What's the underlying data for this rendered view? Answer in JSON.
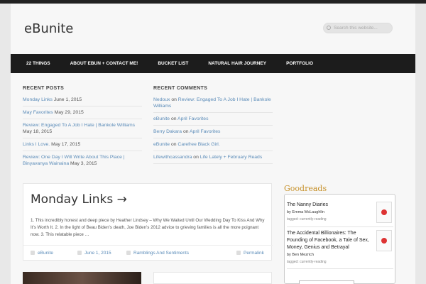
{
  "header": {
    "site_title": "eBunite",
    "search_placeholder": "Search this website..."
  },
  "nav": {
    "items": [
      "22 THINGS",
      "ABOUT EBUN + CONTACT ME!",
      "BUCKET LIST",
      "NATURAL HAIR JOURNEY",
      "PORTFOLIO"
    ]
  },
  "recent_posts": {
    "title": "RECENT POSTS",
    "items": [
      {
        "link": "Monday Links",
        "date": "June 1, 2015"
      },
      {
        "link": "May Favorites",
        "date": "May 29, 2015"
      },
      {
        "link": "Review: Engaged To A Job I Hate | Bankole Williams",
        "date": "May 18, 2015"
      },
      {
        "link": "Links I Love.",
        "date": "May 17, 2015"
      },
      {
        "link": "Review: One Day I Will Write About This Place | Binyavanya Wainaina",
        "date": "May 3, 2015"
      }
    ]
  },
  "recent_comments": {
    "title": "RECENT COMMENTS",
    "items": [
      {
        "author": "Nedoux",
        "on": "on",
        "post": "Review: Engaged To A Job I Hate | Bankole Williams"
      },
      {
        "author": "eBunite",
        "on": "on",
        "post": "April Favorites"
      },
      {
        "author": "Berry Dakara",
        "on": "on",
        "post": "April Favorites"
      },
      {
        "author": "eBunite",
        "on": "on",
        "post": "Carefree Black Girl."
      },
      {
        "author": "Lifewithcassandra",
        "on": "on",
        "post": "Life Lately + February Reads"
      }
    ]
  },
  "post": {
    "title": "Monday Links →",
    "excerpt": "1. This incredibly honest and deep piece by Heather Lindsey – Why We Waited Until Our Wedding Day To Kiss And Why It’s Worth It. 2. In the light of Beau Biden’s death, Joe Biden’s 2012 advice to grieving families is all the more poignant now. 3. This relatable piece …",
    "author": "eBunite",
    "date": "June 1, 2015",
    "category": "Ramblings And Sentiments",
    "permalink": "Permalink"
  },
  "goodreads": {
    "title": "Goodreads",
    "books": [
      {
        "title": "The Nanny Diaries",
        "author": "by Emma McLaughlin",
        "tagged": "tagged: currently-reading"
      },
      {
        "title": "The Accidental Billionaires: The Founding of Facebook, a Tale of Sex, Money, Genius and Betrayal",
        "author": "by Ben Mezrich",
        "tagged": "tagged: currently-reading"
      }
    ]
  }
}
